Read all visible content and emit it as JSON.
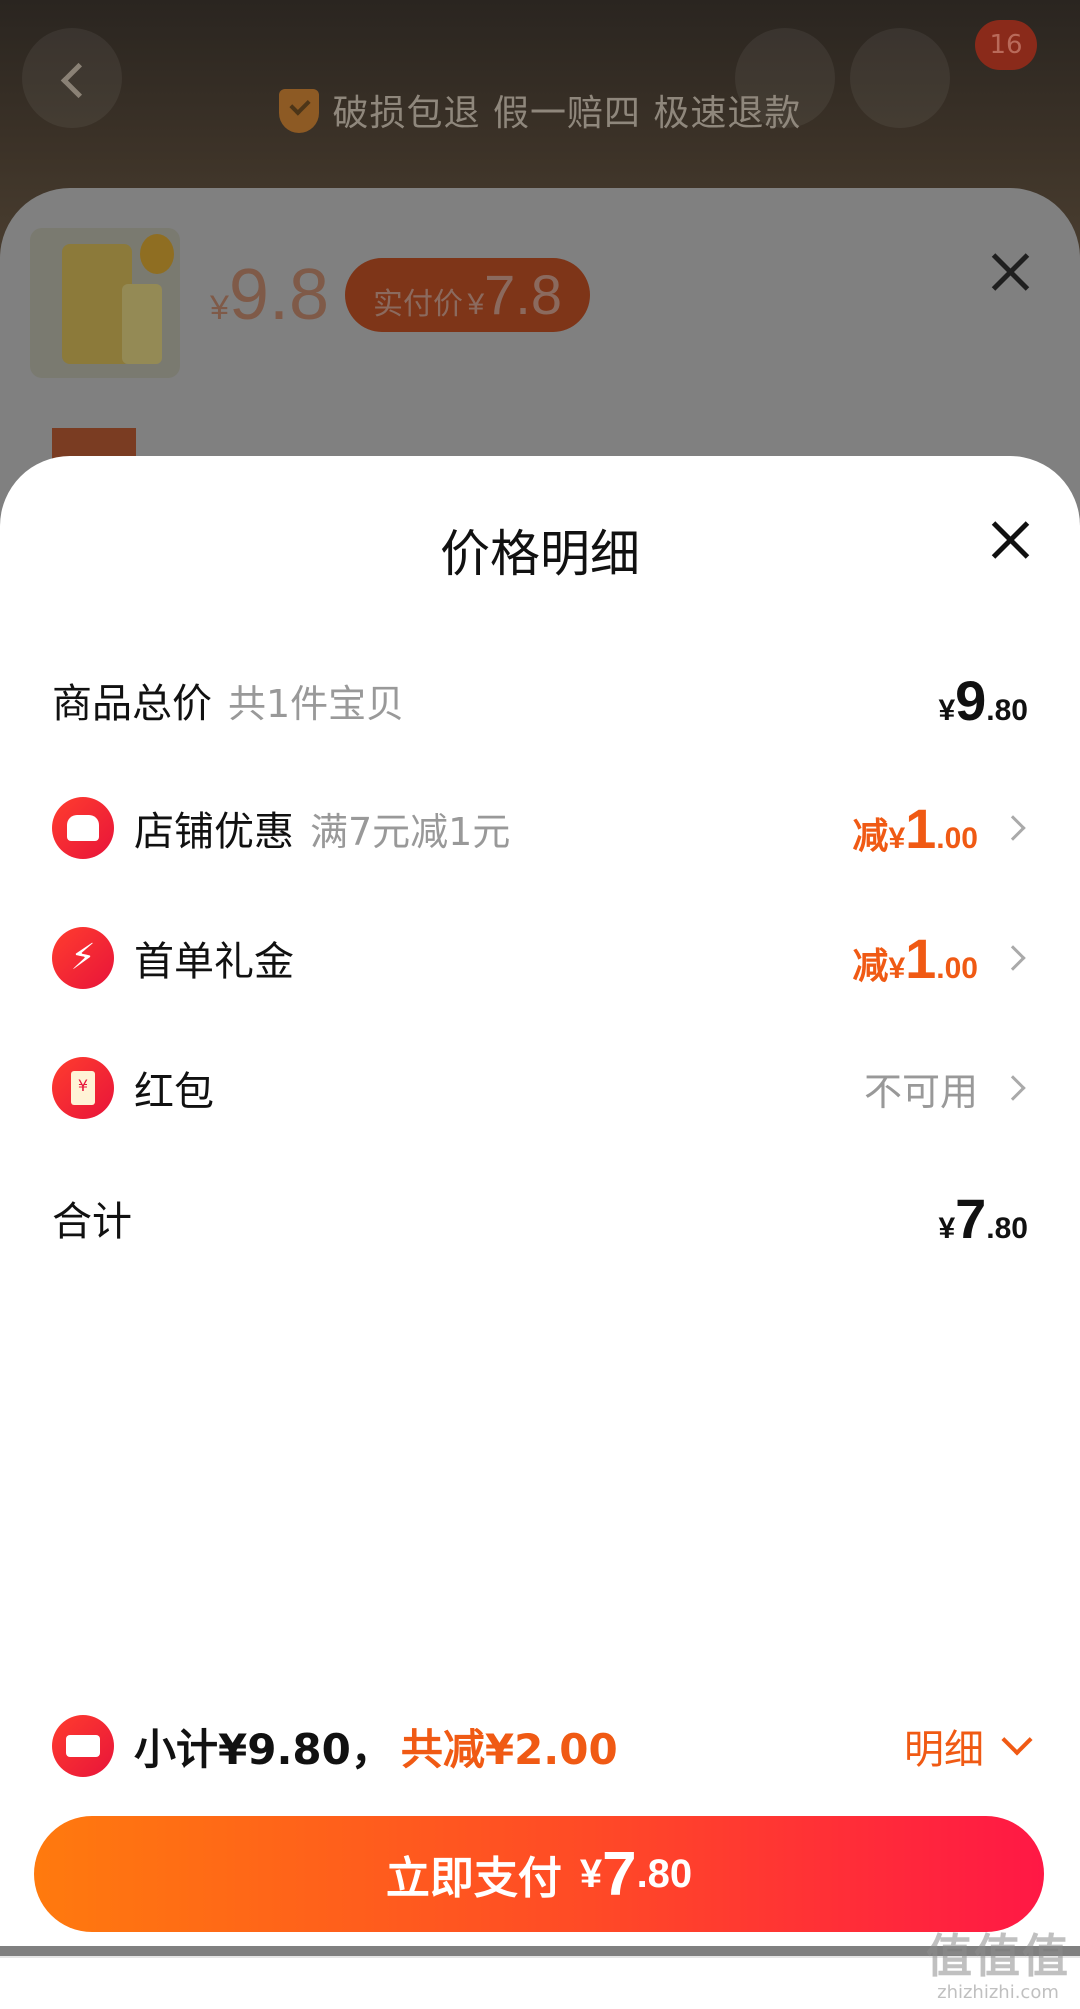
{
  "background": {
    "guarantee_text": "破损包退 假一赔四 极速退款",
    "cart_count": "16",
    "product_price_symbol": "¥",
    "product_price": "9.8",
    "paid_label": "实付价",
    "paid_symbol": "¥",
    "paid_price": "7.8"
  },
  "sheet": {
    "title": "价格明细",
    "rows": [
      {
        "label": "商品总价",
        "hint": "共1件宝贝",
        "yen": "¥",
        "int": "9",
        "dec": ".80"
      },
      {
        "label": "店铺优惠",
        "hint": "满7元减1元",
        "prefix": "减",
        "yen": "¥",
        "int": "1",
        "dec": ".00",
        "icon": "store-icon"
      },
      {
        "label": "首单礼金",
        "prefix": "减",
        "yen": "¥",
        "int": "1",
        "dec": ".00",
        "icon": "lightning-icon"
      },
      {
        "label": "红包",
        "value": "不可用",
        "icon": "red-envelope-icon",
        "icon_glyph": "¥"
      },
      {
        "label": "合计",
        "yen": "¥",
        "int": "7",
        "dec": ".80"
      }
    ]
  },
  "footer": {
    "subtotal": "小计¥9.80，",
    "savings": "共减¥2.00",
    "detail_label": "明细",
    "pay_label": "立即支付",
    "pay_yen": "¥",
    "pay_int": "7",
    "pay_dec": ".80"
  },
  "watermark": {
    "main": "值值值",
    "url": "zhizhizhi.com"
  },
  "colors": {
    "accent": "#f05a14",
    "brand_red": "#e8143a",
    "button_start": "#ff7a0e",
    "button_end": "#ff1845"
  }
}
